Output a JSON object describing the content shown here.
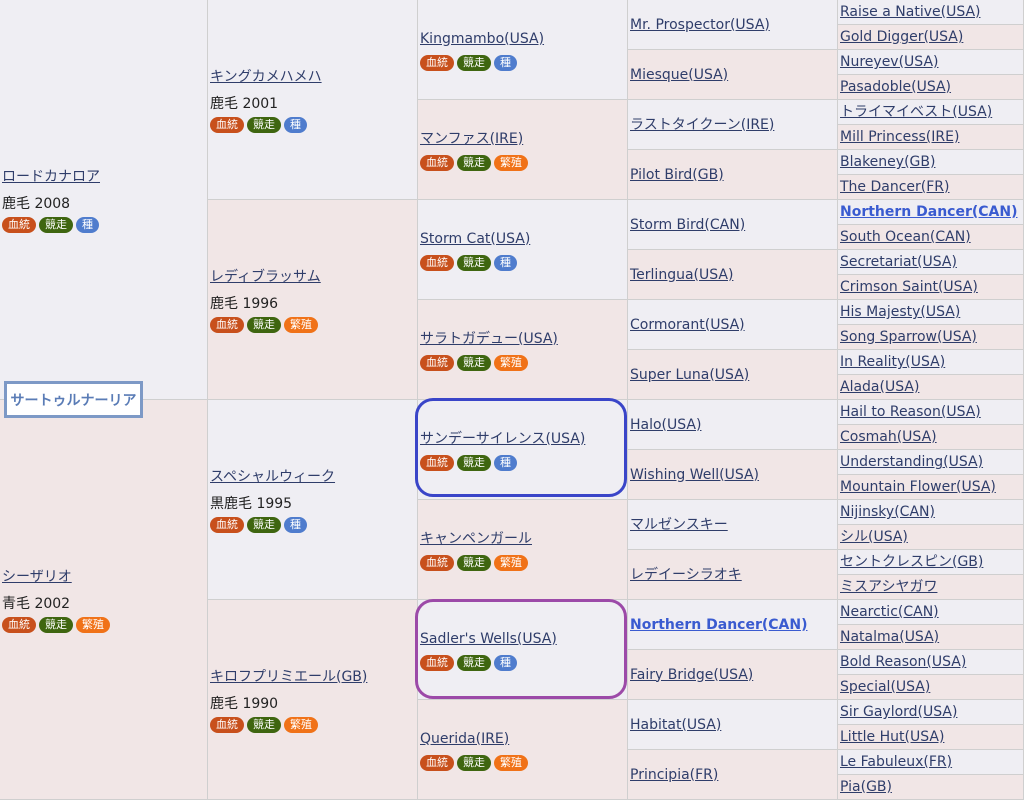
{
  "subject": "サートゥルナーリア",
  "badge_labels": {
    "lineage": "血統",
    "racing": "競走",
    "stallion": "種",
    "breeding": "繁殖"
  },
  "colors": {
    "lineage": "#c8501c",
    "racing": "#3f6610",
    "stallion": "#4f7ccd",
    "breeding": "#f07218",
    "highlight_blue": "#3a45c8",
    "highlight_purple": "#9c4aa8"
  },
  "gen1": [
    {
      "name": "ロードカナロア",
      "coat": "鹿毛 2008",
      "third": "stallion"
    },
    {
      "name": "シーザリオ",
      "coat": "青毛 2002",
      "third": "breeding"
    }
  ],
  "gen2": [
    {
      "name": "キングカメハメハ",
      "coat": "鹿毛 2001",
      "third": "stallion"
    },
    {
      "name": "レディブラッサム",
      "coat": "鹿毛 1996",
      "third": "breeding"
    },
    {
      "name": "スペシャルウィーク",
      "coat": "黒鹿毛 1995",
      "third": "stallion"
    },
    {
      "name": "キロフプリミエール(GB)",
      "coat": "鹿毛 1990",
      "third": "breeding"
    }
  ],
  "gen3": [
    {
      "name": "Kingmambo(USA)",
      "third": "stallion"
    },
    {
      "name": "マンファス(IRE)",
      "third": "breeding"
    },
    {
      "name": "Storm Cat(USA)",
      "third": "stallion"
    },
    {
      "name": "サラトガデュー(USA)",
      "third": "breeding"
    },
    {
      "name": "サンデーサイレンス(USA)",
      "third": "stallion"
    },
    {
      "name": "キャンペンガール",
      "third": "breeding"
    },
    {
      "name": "Sadler's Wells(USA)",
      "third": "stallion"
    },
    {
      "name": "Querida(IRE)",
      "third": "breeding"
    }
  ],
  "gen4": [
    {
      "name": "Mr. Prospector(USA)"
    },
    {
      "name": "Miesque(USA)"
    },
    {
      "name": "ラストタイクーン(IRE)"
    },
    {
      "name": "Pilot Bird(GB)"
    },
    {
      "name": "Storm Bird(CAN)"
    },
    {
      "name": "Terlingua(USA)"
    },
    {
      "name": "Cormorant(USA)"
    },
    {
      "name": "Super Luna(USA)"
    },
    {
      "name": "Halo(USA)"
    },
    {
      "name": "Wishing Well(USA)"
    },
    {
      "name": "マルゼンスキー"
    },
    {
      "name": "レデイーシラオキ"
    },
    {
      "name": "Northern Dancer(CAN)",
      "highlight": true
    },
    {
      "name": "Fairy Bridge(USA)"
    },
    {
      "name": "Habitat(USA)"
    },
    {
      "name": "Principia(FR)"
    }
  ],
  "gen5": [
    {
      "name": "Raise a Native(USA)"
    },
    {
      "name": "Gold Digger(USA)"
    },
    {
      "name": "Nureyev(USA)"
    },
    {
      "name": "Pasadoble(USA)"
    },
    {
      "name": "トライマイベスト(USA)"
    },
    {
      "name": "Mill Princess(IRE)"
    },
    {
      "name": "Blakeney(GB)"
    },
    {
      "name": "The Dancer(FR)"
    },
    {
      "name": "Northern Dancer(CAN)",
      "highlight": true
    },
    {
      "name": "South Ocean(CAN)"
    },
    {
      "name": "Secretariat(USA)"
    },
    {
      "name": "Crimson Saint(USA)"
    },
    {
      "name": "His Majesty(USA)"
    },
    {
      "name": "Song Sparrow(USA)"
    },
    {
      "name": "In Reality(USA)"
    },
    {
      "name": "Alada(USA)"
    },
    {
      "name": "Hail to Reason(USA)"
    },
    {
      "name": "Cosmah(USA)"
    },
    {
      "name": "Understanding(USA)"
    },
    {
      "name": "Mountain Flower(USA)"
    },
    {
      "name": "Nijinsky(CAN)"
    },
    {
      "name": "シル(USA)"
    },
    {
      "name": "セントクレスピン(GB)"
    },
    {
      "name": "ミスアシヤガワ"
    },
    {
      "name": "Nearctic(CAN)"
    },
    {
      "name": "Natalma(USA)"
    },
    {
      "name": "Bold Reason(USA)"
    },
    {
      "name": "Special(USA)"
    },
    {
      "name": "Sir Gaylord(USA)"
    },
    {
      "name": "Little Hut(USA)"
    },
    {
      "name": "Le Fabuleux(FR)"
    },
    {
      "name": "Pia(GB)"
    }
  ]
}
